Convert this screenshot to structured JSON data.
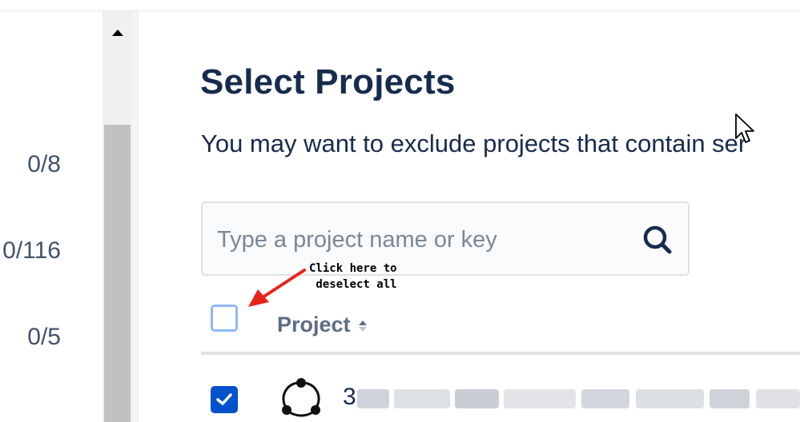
{
  "sidebar": {
    "counts": [
      "0/8",
      "0/116",
      "0/5"
    ]
  },
  "main": {
    "title": "Select Projects",
    "description": "You may want to exclude projects that contain ser",
    "search": {
      "placeholder": "Type a project name or key",
      "value": ""
    },
    "annotation": "Click here to\n deselect all",
    "table": {
      "header": {
        "select_all_checked": false,
        "project_label": "Project"
      },
      "rows": [
        {
          "checked": true,
          "name": "3",
          "name_blurred": true
        }
      ]
    }
  },
  "colors": {
    "title": "#172b4d",
    "muted": "#5e6c84",
    "checkbox_checked": "#0052cc",
    "checkbox_border": "#8fb8f6",
    "annotation_arrow": "#e8231c"
  },
  "icons": [
    "scroll-up-arrow-icon",
    "search-icon",
    "sort-icon",
    "checkmark-icon",
    "project-avatar-icon",
    "mouse-pointer-icon",
    "red-arrow-icon"
  ]
}
